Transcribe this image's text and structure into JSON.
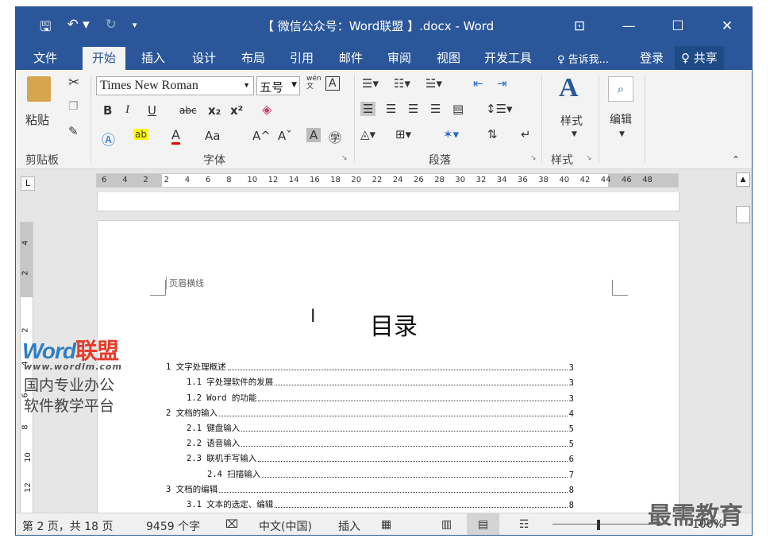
{
  "titlebar": {
    "title": "【 微信公众号：Word联盟 】.docx - Word",
    "save_glyph": "🖫",
    "undo_glyph": "↶ ▾",
    "redo_glyph": "↻",
    "qat_more": "▾",
    "ribbon_display": "⊡",
    "minimize": "—",
    "maximize": "☐",
    "close": "✕"
  },
  "tabs": {
    "file": "文件",
    "home": "开始",
    "insert": "插入",
    "design": "设计",
    "layout": "布局",
    "references": "引用",
    "mailings": "邮件",
    "review": "审阅",
    "view": "视图",
    "developer": "开发工具",
    "tellme": "♀ 告诉我...",
    "login": "登录",
    "share": "♀ 共享"
  },
  "ribbon": {
    "paste": "粘贴",
    "clipboard": "剪贴板",
    "font_name": "Times New Roman",
    "font_size": "五号",
    "font_group": "字体",
    "paragraph_group": "段落",
    "styles": "样式",
    "styles_group": "样式",
    "editing": "编辑",
    "bold": "B",
    "italic": "I",
    "underline": "U",
    "strike": "abc",
    "subscript": "x₂",
    "superscript": "x²",
    "change_case": "Aa",
    "grow": "A^",
    "shrink": "Aˇ",
    "phonetic": "wén\n文",
    "border_char": "A",
    "enclose": "㊫"
  },
  "ruler": {
    "h_numbers": [
      "6",
      "4",
      "2",
      "2",
      "4",
      "6",
      "8",
      "10",
      "12",
      "14",
      "16",
      "18",
      "20",
      "22",
      "24",
      "26",
      "28",
      "30",
      "32",
      "34",
      "36",
      "38",
      "40",
      "42",
      "44",
      "46",
      "48"
    ],
    "v_numbers": [
      "4",
      "2",
      "2",
      "4",
      "6",
      "8",
      "10",
      "12"
    ]
  },
  "document": {
    "header_label": "页眉横线",
    "toc_title": "目录",
    "toc": [
      {
        "level": 1,
        "text": "1 文字处理概述",
        "page": "3"
      },
      {
        "level": 2,
        "text": "1.1 字处理软件的发展",
        "page": "3"
      },
      {
        "level": 2,
        "text": "1.2 Word 的功能",
        "page": "3"
      },
      {
        "level": 1,
        "text": "2 文档的输入",
        "page": "4"
      },
      {
        "level": 2,
        "text": "2.1 键盘输入",
        "page": "5"
      },
      {
        "level": 2,
        "text": "2.2 语音输入",
        "page": "5"
      },
      {
        "level": 2,
        "text": "2.3 联机手写输入",
        "page": "6"
      },
      {
        "level": 3,
        "text": "2.4 扫描输入",
        "page": "7"
      },
      {
        "level": 1,
        "text": "3 文档的编辑",
        "page": "8"
      },
      {
        "level": 2,
        "text": "3.1 文本的选定、编辑",
        "page": "8"
      }
    ]
  },
  "status": {
    "page": "第 2 页，共 18 页",
    "words": "9459 个字",
    "language": "中文(中国)",
    "mode": "插入",
    "zoom": "100%"
  },
  "watermark": {
    "brand_a": "Word",
    "brand_b": "联盟",
    "url": "www.wordlm.com",
    "line1": "国内专业办公",
    "line2": "软件教学平台",
    "corner": "最需教育"
  },
  "colors": {
    "accent": "#2b579a"
  }
}
